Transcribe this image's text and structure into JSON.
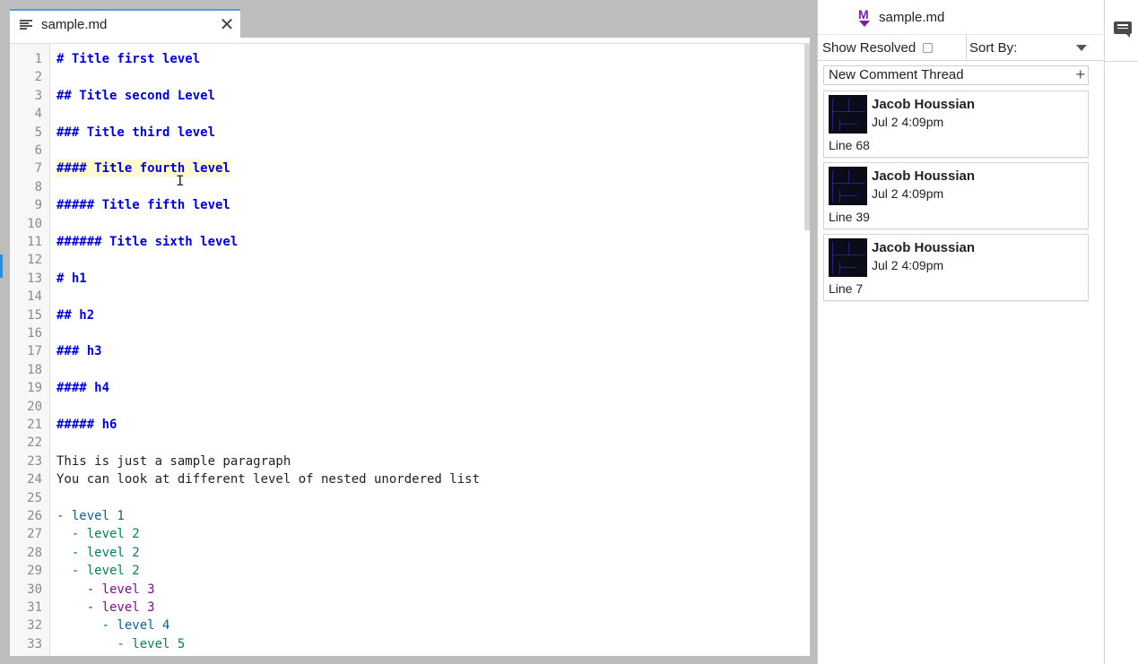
{
  "editor": {
    "tab_label": "sample.md",
    "tab_close": "✕",
    "cursor_glyph": "I",
    "lines": [
      {
        "n": "1",
        "text": "# Title first level",
        "cls": "h"
      },
      {
        "n": "2",
        "text": "",
        "cls": ""
      },
      {
        "n": "3",
        "text": "## Title second Level",
        "cls": "h"
      },
      {
        "n": "4",
        "text": "",
        "cls": ""
      },
      {
        "n": "5",
        "text": "### Title third level",
        "cls": "h"
      },
      {
        "n": "6",
        "text": "",
        "cls": ""
      },
      {
        "n": "7",
        "text": "#### Title fourth level",
        "cls": "h hl"
      },
      {
        "n": "8",
        "text": "",
        "cls": ""
      },
      {
        "n": "9",
        "text": "##### Title fifth level",
        "cls": "h"
      },
      {
        "n": "10",
        "text": "",
        "cls": ""
      },
      {
        "n": "11",
        "text": "###### Title sixth level",
        "cls": "h"
      },
      {
        "n": "12",
        "text": "",
        "cls": ""
      },
      {
        "n": "13",
        "text": "# h1",
        "cls": "h"
      },
      {
        "n": "14",
        "text": "",
        "cls": ""
      },
      {
        "n": "15",
        "text": "## h2",
        "cls": "h"
      },
      {
        "n": "16",
        "text": "",
        "cls": ""
      },
      {
        "n": "17",
        "text": "### h3",
        "cls": "h"
      },
      {
        "n": "18",
        "text": "",
        "cls": ""
      },
      {
        "n": "19",
        "text": "#### h4",
        "cls": "h"
      },
      {
        "n": "20",
        "text": "",
        "cls": ""
      },
      {
        "n": "21",
        "text": "##### h6",
        "cls": "h"
      },
      {
        "n": "22",
        "text": "",
        "cls": ""
      },
      {
        "n": "23",
        "text": "This is just a sample paragraph",
        "cls": ""
      },
      {
        "n": "24",
        "text": "You can look at different level of nested unordered list",
        "cls": ""
      },
      {
        "n": "25",
        "text": "",
        "cls": ""
      },
      {
        "n": "26",
        "text": "- level 1",
        "cls": "l1"
      },
      {
        "n": "27",
        "text": "  - level 2",
        "cls": "l2"
      },
      {
        "n": "28",
        "text": "  - level 2",
        "cls": "l2"
      },
      {
        "n": "29",
        "text": "  - level 2",
        "cls": "l2"
      },
      {
        "n": "30",
        "text": "    - level 3",
        "cls": "l3"
      },
      {
        "n": "31",
        "text": "    - level 3",
        "cls": "l3"
      },
      {
        "n": "32",
        "text": "      - level 4",
        "cls": "l1"
      },
      {
        "n": "33",
        "text": "        - level 5",
        "cls": "l2"
      }
    ]
  },
  "comments": {
    "title": "sample.md",
    "file_icon_letter": "M",
    "show_resolved_label": "Show Resolved",
    "sort_by_label": "Sort By:",
    "new_thread_label": "New Comment Thread",
    "new_thread_plus": "+",
    "threads": [
      {
        "author": "Jacob Houssian",
        "time": "Jul 2 4:09pm",
        "line": "Line 68"
      },
      {
        "author": "Jacob Houssian",
        "time": "Jul 2 4:09pm",
        "line": "Line 39"
      },
      {
        "author": "Jacob Houssian",
        "time": "Jul 2 4:09pm",
        "line": "Line 7"
      }
    ]
  },
  "colors": {
    "heading": "#0000cc",
    "list_level_1": "#0b5f8a",
    "list_level_2": "#0a7a5a",
    "list_level_3": "#7a0f8a",
    "markdown_icon": "#7b1fa2",
    "tab_accent": "#5b9bd5"
  },
  "icons": {
    "tab": "file-lines-icon",
    "close": "close-icon",
    "markdown": "markdown-file-icon",
    "sort": "chevron-down-icon",
    "add": "plus-icon",
    "comments_toggle": "comment-icon"
  }
}
